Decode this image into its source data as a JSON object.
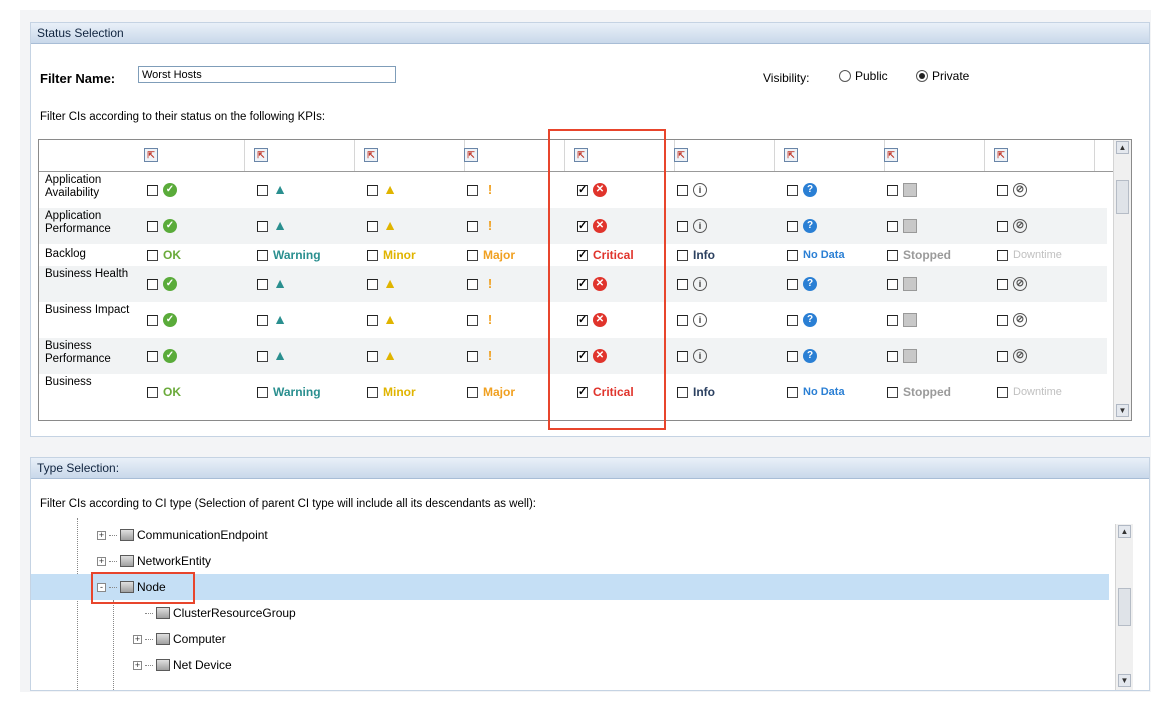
{
  "status_panel": {
    "title": "Status Selection",
    "filter_name_label": "Filter Name:",
    "filter_name_value": "Worst Hosts",
    "visibility_label": "Visibility:",
    "visibility_options": [
      {
        "label": "Public",
        "selected": false
      },
      {
        "label": "Private",
        "selected": true
      }
    ],
    "kpi_intro": "Filter CIs according to their status on the following KPIs:",
    "status_columns": [
      {
        "key": "ok",
        "label": "OK",
        "icon": "ok-icon"
      },
      {
        "key": "warning",
        "label": "Warning",
        "icon": "warning-icon"
      },
      {
        "key": "minor",
        "label": "Minor",
        "icon": "minor-icon"
      },
      {
        "key": "major",
        "label": "Major",
        "icon": "major-icon"
      },
      {
        "key": "critical",
        "label": "Critical",
        "icon": "critical-icon"
      },
      {
        "key": "info",
        "label": "Info",
        "icon": "info-icon"
      },
      {
        "key": "nodata",
        "label": "No Data",
        "icon": "no-data-icon"
      },
      {
        "key": "stopped",
        "label": "Stopped",
        "icon": "stopped-icon"
      },
      {
        "key": "downtime",
        "label": "Downtime",
        "icon": "downtime-icon"
      }
    ],
    "kpi_rows": [
      {
        "label": "Application Availability",
        "display": "icon",
        "checked": [
          false,
          false,
          false,
          false,
          true,
          false,
          false,
          false,
          false
        ]
      },
      {
        "label": "Application Performance",
        "display": "icon",
        "checked": [
          false,
          false,
          false,
          false,
          true,
          false,
          false,
          false,
          false
        ]
      },
      {
        "label": "Backlog",
        "display": "text",
        "checked": [
          false,
          false,
          false,
          false,
          true,
          false,
          false,
          false,
          false
        ]
      },
      {
        "label": "Business Health",
        "display": "icon",
        "checked": [
          false,
          false,
          false,
          false,
          true,
          false,
          false,
          false,
          false
        ]
      },
      {
        "label": "Business Impact",
        "display": "icon",
        "checked": [
          false,
          false,
          false,
          false,
          true,
          false,
          false,
          false,
          false
        ]
      },
      {
        "label": "Business Performance",
        "display": "icon",
        "checked": [
          false,
          false,
          false,
          false,
          true,
          false,
          false,
          false,
          false
        ]
      },
      {
        "label": "Business",
        "display": "text",
        "checked": [
          false,
          false,
          false,
          false,
          true,
          false,
          false,
          false,
          false
        ]
      }
    ]
  },
  "type_panel": {
    "title": "Type Selection:",
    "intro": "Filter CIs according to CI type (Selection of parent CI type will include all its descendants as well):",
    "tree": [
      {
        "label": "CommunicationEndpoint",
        "expander": "+",
        "level": 1
      },
      {
        "label": "NetworkEntity",
        "expander": "+",
        "level": 1
      },
      {
        "label": "Node",
        "expander": "-",
        "level": 1,
        "selected": true
      },
      {
        "label": "ClusterResourceGroup",
        "expander": "",
        "level": 2
      },
      {
        "label": "Computer",
        "expander": "+",
        "level": 2
      },
      {
        "label": "Net Device",
        "expander": "+",
        "level": 2
      }
    ]
  },
  "colors": {
    "highlight_box": "#e8452c",
    "selected_row": "#c5dff5",
    "header_gradient": "#c9d8ea"
  }
}
